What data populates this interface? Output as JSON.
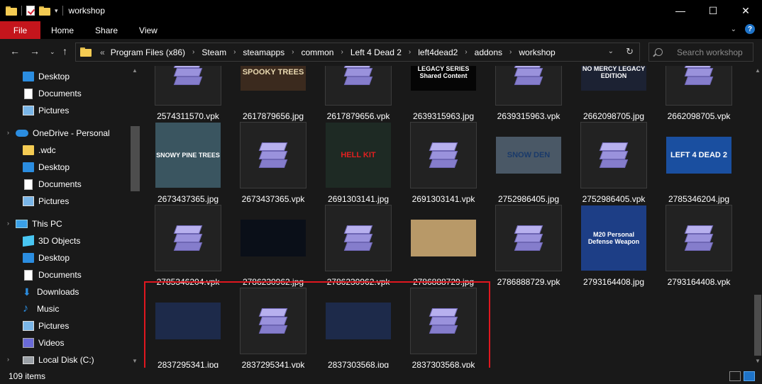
{
  "window": {
    "title": "workshop"
  },
  "ribbon": {
    "tabs": [
      "File",
      "Home",
      "Share",
      "View"
    ]
  },
  "address": {
    "prefix": "«",
    "crumbs": [
      "Program Files (x86)",
      "Steam",
      "steamapps",
      "common",
      "Left 4 Dead 2",
      "left4dead2",
      "addons",
      "workshop"
    ]
  },
  "search": {
    "placeholder": "Search workshop"
  },
  "nav": {
    "items": [
      {
        "label": "Desktop",
        "icon": "desktop-icon"
      },
      {
        "label": "Documents",
        "icon": "documents-icon"
      },
      {
        "label": "Pictures",
        "icon": "pictures-icon"
      },
      {
        "label": "OneDrive - Personal",
        "icon": "onedrive-icon"
      },
      {
        "label": ".wdc",
        "icon": "folder-icon"
      },
      {
        "label": "Desktop",
        "icon": "desktop-icon"
      },
      {
        "label": "Documents",
        "icon": "documents-icon"
      },
      {
        "label": "Pictures",
        "icon": "pictures-icon"
      },
      {
        "label": "This PC",
        "icon": "this-pc-icon"
      },
      {
        "label": "3D Objects",
        "icon": "3d-objects-icon"
      },
      {
        "label": "Desktop",
        "icon": "desktop-icon"
      },
      {
        "label": "Documents",
        "icon": "documents-icon"
      },
      {
        "label": "Downloads",
        "icon": "downloads-icon"
      },
      {
        "label": "Music",
        "icon": "music-icon"
      },
      {
        "label": "Pictures",
        "icon": "pictures-icon"
      },
      {
        "label": "Videos",
        "icon": "videos-icon"
      },
      {
        "label": "Local Disk (C:)",
        "icon": "local-disk-icon"
      }
    ]
  },
  "files": [
    {
      "name": "2574311570.vpk",
      "kind": "vpk"
    },
    {
      "name": "2617879656.jpg",
      "kind": "img",
      "art": "SPOOKY TREES",
      "bg": "#3b2a1e",
      "fg": "#e8d8b0"
    },
    {
      "name": "2617879656.vpk",
      "kind": "vpk"
    },
    {
      "name": "2639315963.jpg",
      "kind": "img",
      "art": "LEGACY SERIES Shared Content",
      "bg": "#050505",
      "fg": "#ffffff"
    },
    {
      "name": "2639315963.vpk",
      "kind": "vpk"
    },
    {
      "name": "2662098705.jpg",
      "kind": "img",
      "art": "NO MERCY LEGACY EDITION",
      "bg": "#1c2233",
      "fg": "#ffffff"
    },
    {
      "name": "2662098705.vpk",
      "kind": "vpk"
    },
    {
      "name": "2673437365.jpg",
      "kind": "img",
      "art": "SNOWY PINE TREES",
      "bg": "#3a5560",
      "fg": "#ffffff"
    },
    {
      "name": "2673437365.vpk",
      "kind": "vpk"
    },
    {
      "name": "2691303141.jpg",
      "kind": "img",
      "art": "HELL KIT",
      "bg": "#1e2a24",
      "fg": "#e02020"
    },
    {
      "name": "2691303141.vpk",
      "kind": "vpk"
    },
    {
      "name": "2752986405.jpg",
      "kind": "img",
      "art": "SNOW DEN",
      "bg": "#4a5866",
      "fg": "#1a3a6a"
    },
    {
      "name": "2752986405.vpk",
      "kind": "vpk"
    },
    {
      "name": "2785346204.jpg",
      "kind": "img",
      "art": "LEFT 4 DEAD 2",
      "bg": "#1a4fa0",
      "fg": "#ffffff"
    },
    {
      "name": "2785346204.vpk",
      "kind": "vpk"
    },
    {
      "name": "2786230962.jpg",
      "kind": "img",
      "art": "",
      "bg": "#0a0f18",
      "fg": "#9fc8e8"
    },
    {
      "name": "2786230962.vpk",
      "kind": "vpk"
    },
    {
      "name": "2786888729.jpg",
      "kind": "img",
      "art": "",
      "bg": "#b89968",
      "fg": "#222"
    },
    {
      "name": "2786888729.vpk",
      "kind": "vpk"
    },
    {
      "name": "2793164408.jpg",
      "kind": "img",
      "art": "M20 Personal Defense Weapon",
      "bg": "#1d3e86",
      "fg": "#ffffff"
    },
    {
      "name": "2793164408.vpk",
      "kind": "vpk"
    },
    {
      "name": "2837295341.jpg",
      "kind": "img",
      "art": "",
      "bg": "#1d2a4a",
      "fg": "#ffffff"
    },
    {
      "name": "2837295341.vpk",
      "kind": "vpk"
    },
    {
      "name": "2837303568.jpg",
      "kind": "img",
      "art": "",
      "bg": "#1d2a4a",
      "fg": "#ffffff"
    },
    {
      "name": "2837303568.vpk",
      "kind": "vpk"
    }
  ],
  "status": {
    "count": "109 items"
  },
  "colors": {
    "accent": "#1e73c8",
    "file_tab": "#c4151c",
    "selection_box": "#e0171f"
  }
}
